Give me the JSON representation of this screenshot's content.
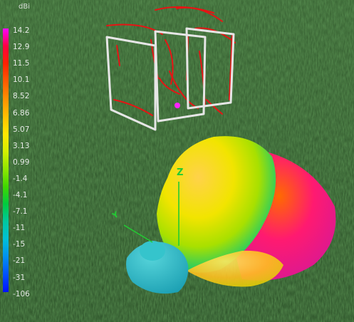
{
  "legend": {
    "unit": "dBi",
    "ticks": [
      "14.2",
      "12.9",
      "11.5",
      "10.1",
      "8.52",
      "6.86",
      "5.07",
      "3.13",
      "0.99",
      "-1.4",
      "-4.1",
      "-7.1",
      "-11",
      "-15",
      "-21",
      "-31",
      "-106"
    ],
    "colors": [
      "#ff00ff",
      "#ff0040",
      "#ff2200",
      "#ff5a00",
      "#ff9000",
      "#ffc000",
      "#ffe800",
      "#d4f000",
      "#90e800",
      "#40d800",
      "#00cc40",
      "#00c8a0",
      "#00c0d8",
      "#0090f0",
      "#0050ff",
      "#0010ff"
    ]
  },
  "axes": {
    "z_label": "Z",
    "y_label": "Y",
    "z_color": "#22cc33",
    "y_color": "#22cc33"
  },
  "colors": {
    "ground": "#2f5a2c",
    "wire_frame": "#e6e6e6",
    "current_trace": "#e61414",
    "feed_point": "#ff22ff"
  }
}
